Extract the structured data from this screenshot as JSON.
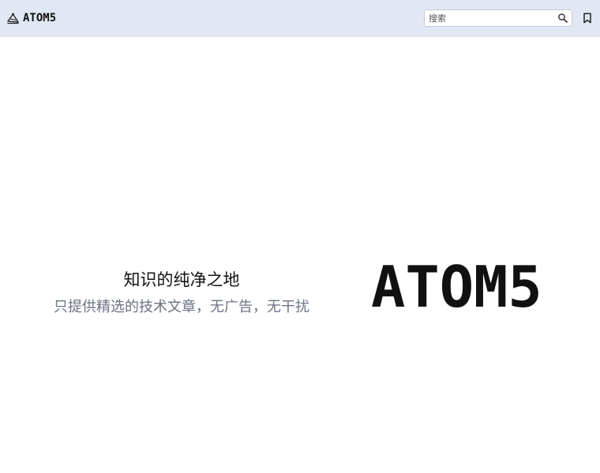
{
  "header": {
    "brand_name": "ATOM5",
    "logo_icon": "atom5-logo-icon",
    "search": {
      "placeholder": "搜索",
      "value": "",
      "icon": "search-icon"
    },
    "bookmark_icon": "bookmark-icon"
  },
  "hero": {
    "title": "知识的纯净之地",
    "subtitle": "只提供精选的技术文章，无广告，无干扰",
    "logo_text": "ATOM5"
  },
  "colors": {
    "header_bg": "#e1e8f3",
    "text_primary": "#111111",
    "text_secondary": "#6b7383"
  }
}
